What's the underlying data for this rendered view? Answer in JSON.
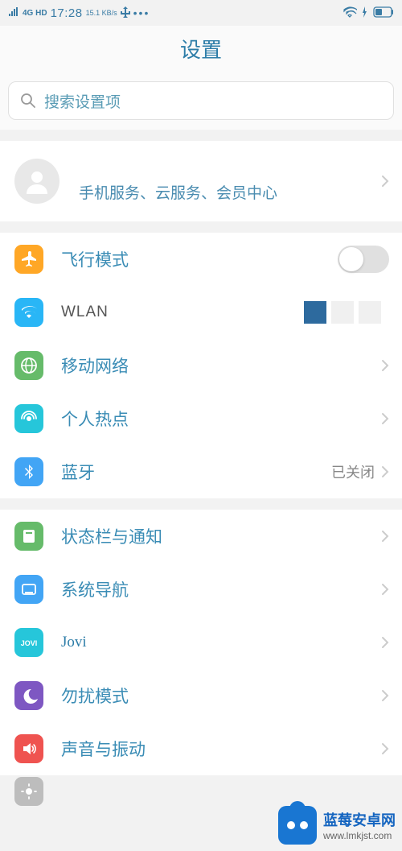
{
  "status_bar": {
    "signal": "4G HD",
    "time": "17:28",
    "speed": "15.1\nKB/s",
    "usb": "⏏",
    "dots": "•••"
  },
  "header": {
    "title": "设置"
  },
  "search": {
    "placeholder": "搜索设置项"
  },
  "account": {
    "subtitle": "手机服务、云服务、会员中心"
  },
  "groups": [
    {
      "rows": [
        {
          "key": "airplane",
          "label": "飞行模式",
          "icon": "airplane-icon",
          "bg": "bg-orange",
          "type": "toggle",
          "value": false
        },
        {
          "key": "wlan",
          "label": "WLAN",
          "icon": "wifi-icon",
          "bg": "bg-blue",
          "type": "wlan-blocks",
          "labelClass": "wlan-label"
        },
        {
          "key": "mobile",
          "label": "移动网络",
          "icon": "globe-icon",
          "bg": "bg-green",
          "type": "chevron"
        },
        {
          "key": "hotspot",
          "label": "个人热点",
          "icon": "hotspot-icon",
          "bg": "bg-cyan",
          "type": "chevron"
        },
        {
          "key": "bluetooth",
          "label": "蓝牙",
          "icon": "bluetooth-icon",
          "bg": "bg-blue2",
          "type": "chevron",
          "value": "已关闭"
        }
      ]
    },
    {
      "rows": [
        {
          "key": "statusbar",
          "label": "状态栏与通知",
          "icon": "notification-icon",
          "bg": "bg-green2",
          "type": "chevron"
        },
        {
          "key": "navigation",
          "label": "系统导航",
          "icon": "nav-icon",
          "bg": "bg-blue3",
          "type": "chevron"
        },
        {
          "key": "jovi",
          "label": "Jovi",
          "icon": "jovi-icon",
          "bg": "bg-cyan2",
          "type": "chevron",
          "labelClass": "jovi-label"
        },
        {
          "key": "dnd",
          "label": "勿扰模式",
          "icon": "moon-icon",
          "bg": "bg-purple",
          "type": "chevron"
        },
        {
          "key": "sound",
          "label": "声音与振动",
          "icon": "sound-icon",
          "bg": "bg-red",
          "type": "chevron"
        }
      ]
    }
  ],
  "watermark": {
    "title": "蓝莓安卓网",
    "url": "www.lmkjst.com"
  }
}
